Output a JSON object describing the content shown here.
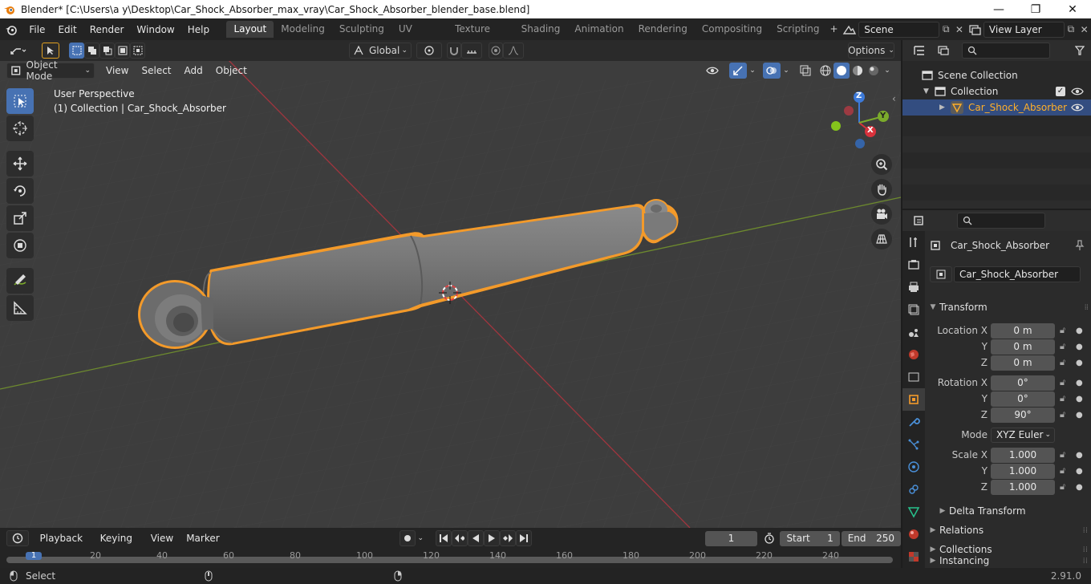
{
  "titlebar": {
    "title": "Blender* [C:\\Users\\a y\\Desktop\\Car_Shock_Absorber_max_vray\\Car_Shock_Absorber_blender_base.blend]",
    "minimize": "—",
    "maximize": "❐",
    "close": "✕"
  },
  "menu": {
    "items": [
      "File",
      "Edit",
      "Render",
      "Window",
      "Help"
    ]
  },
  "workspaces": {
    "tabs": [
      "Layout",
      "Modeling",
      "Sculpting",
      "UV Editing",
      "Texture Paint",
      "Shading",
      "Animation",
      "Rendering",
      "Compositing",
      "Scripting"
    ],
    "active": "Layout",
    "add": "+"
  },
  "scene": {
    "name": "Scene",
    "view_layer": "View Layer"
  },
  "viewport_header": {
    "orientation": "Global",
    "options": "Options",
    "mode": "Object Mode",
    "menus": [
      "View",
      "Select",
      "Add",
      "Object"
    ]
  },
  "viewport": {
    "perspective": "User Perspective",
    "collection_info": "(1) Collection | Car_Shock_Absorber",
    "gizmo": {
      "x": "X",
      "y": "Y",
      "z": "Z"
    }
  },
  "outliner": {
    "scene_collection": "Scene Collection",
    "collection": "Collection",
    "object": "Car_Shock_Absorber"
  },
  "properties": {
    "object_name": "Car_Shock_Absorber",
    "data_name": "Car_Shock_Absorber",
    "transform_label": "Transform",
    "location_label": "Location X",
    "y_label": "Y",
    "z_label": "Z",
    "rotation_label": "Rotation X",
    "scale_label": "Scale X",
    "mode_label": "Mode",
    "location": {
      "x": "0 m",
      "y": "0 m",
      "z": "0 m"
    },
    "rotation": {
      "x": "0°",
      "y": "0°",
      "z": "90°"
    },
    "rotation_mode": "XYZ Euler",
    "scale": {
      "x": "1.000",
      "y": "1.000",
      "z": "1.000"
    },
    "delta_transform": "Delta Transform",
    "relations": "Relations",
    "collections": "Collections",
    "instancing": "Instancing"
  },
  "timeline": {
    "menus": [
      "Playback",
      "Keying",
      "View",
      "Marker"
    ],
    "current_frame": "1",
    "start_label": "Start",
    "start": "1",
    "end_label": "End",
    "end": "250",
    "current_marker": "1",
    "ruler": [
      "20",
      "40",
      "60",
      "80",
      "100",
      "120",
      "140",
      "160",
      "180",
      "200",
      "220",
      "240"
    ]
  },
  "statusbar": {
    "left": "Select",
    "version": "2.91.0"
  },
  "colors": {
    "accent": "#4772b3",
    "selection_outline": "#f39a2a",
    "x_axis": "#d9323c",
    "y_axis": "#7bab2b",
    "z_axis": "#3d7ad9"
  }
}
